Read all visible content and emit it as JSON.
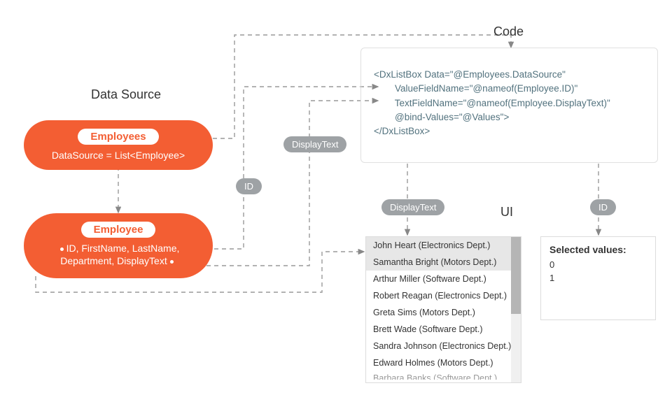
{
  "sections": {
    "data_source": "Data Source",
    "code": "Code",
    "ui": "UI"
  },
  "bubbles": {
    "employees": {
      "pill": "Employees",
      "sub": "DataSource = List<Employee>"
    },
    "employee": {
      "pill": "Employee",
      "line1": "ID, FirstName, LastName,",
      "line2": "Department, DisplayText"
    }
  },
  "tags": {
    "id_upper": "ID",
    "displaytext_upper": "DisplayText",
    "displaytext_lower": "DisplayText",
    "id_lower": "ID"
  },
  "code": {
    "l1": "<DxListBox Data=\"@Employees.DataSource\"",
    "l2": "        ValueFieldName=\"@nameof(Employee.ID)\"",
    "l3": "        TextFieldName=\"@nameof(Employee.DisplayText)\"",
    "l4": "        @bind-Values=\"@Values\">",
    "l5": "</DxListBox>"
  },
  "listbox": {
    "items": [
      "John Heart (Electronics Dept.)",
      "Samantha Bright (Motors Dept.)",
      "Arthur Miller (Software Dept.)",
      "Robert Reagan (Electronics Dept.)",
      "Greta Sims (Motors Dept.)",
      "Brett Wade (Software Dept.)",
      "Sandra Johnson (Electronics Dept.)",
      "Edward Holmes (Motors Dept.)",
      "Barbara Banks (Software Dept.)"
    ],
    "selected_indices": [
      0,
      1
    ]
  },
  "selected": {
    "header": "Selected values:",
    "values": [
      "0",
      "1"
    ]
  },
  "colors": {
    "accent": "#f35e33",
    "tag": "#9ea2a5",
    "codetext": "#52727e"
  }
}
